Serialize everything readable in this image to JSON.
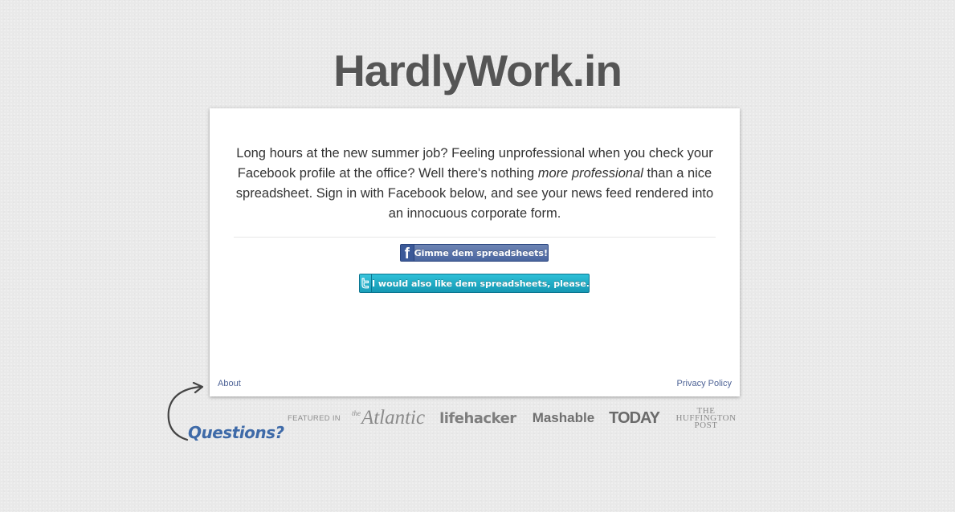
{
  "logo": "HardlyWork.in",
  "intro": {
    "part1": "Long hours at the new summer job? Feeling unprofessional when you check your Facebook profile at the office? Well there's nothing ",
    "emphasis": "more professional",
    "part2": " than a nice spreadsheet. Sign in with Facebook below, and see your news feed rendered into an innocuous corporate form."
  },
  "buttons": {
    "facebook_label": "Gimme dem spreadsheets!",
    "twitter_label": "I would also like dem spreadsheets, please."
  },
  "footer": {
    "about": "About",
    "privacy": "Privacy Policy"
  },
  "questions": "Questions?",
  "press": {
    "featured_label": "FEATURED IN",
    "atlantic_prefix": "the",
    "atlantic": "Atlantic",
    "lifehacker": "lifehacker",
    "mashable": "Mashable",
    "today": "TODAY",
    "huffington_line1": "THE",
    "huffington_line2": "HUFFINGTON",
    "huffington_line3": "POST"
  },
  "colors": {
    "background": "#e9e9e9",
    "facebook_blue": "#4a66a0",
    "twitter_teal": "#1ba9c4",
    "link": "#4e6396",
    "questions": "#3e6aa8"
  },
  "icons": {
    "facebook": "facebook-icon",
    "twitter": "twitter-icon",
    "arrow": "curved-arrow-icon"
  }
}
